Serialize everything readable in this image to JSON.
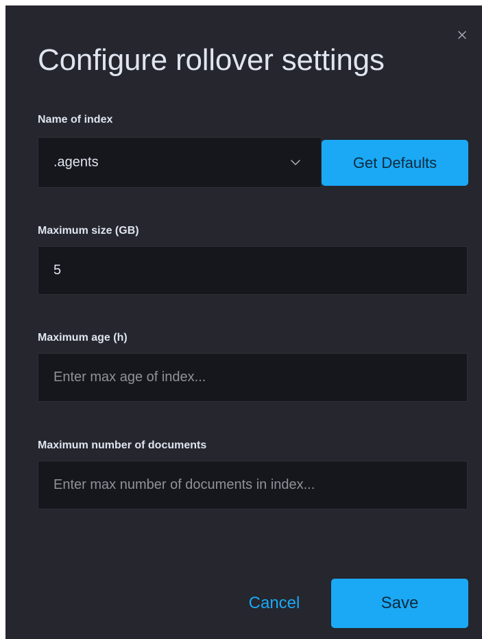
{
  "modal": {
    "title": "Configure rollover settings",
    "close_icon": "close-icon"
  },
  "index_name": {
    "label": "Name of index",
    "selected": ".agents",
    "dropdown_icon": "chevron-down-icon",
    "defaults_button": "Get Defaults"
  },
  "max_size": {
    "label": "Maximum size (GB)",
    "value": "5",
    "placeholder": ""
  },
  "max_age": {
    "label": "Maximum age (h)",
    "value": "",
    "placeholder": "Enter max age of index..."
  },
  "max_docs": {
    "label": "Maximum number of documents",
    "value": "",
    "placeholder": "Enter max number of documents in index..."
  },
  "footer": {
    "cancel_label": "Cancel",
    "save_label": "Save"
  },
  "colors": {
    "background": "#25262e",
    "input_background": "#16171c",
    "accent": "#1ba9f5",
    "text": "#dfe5ef",
    "placeholder": "#8e9299"
  }
}
